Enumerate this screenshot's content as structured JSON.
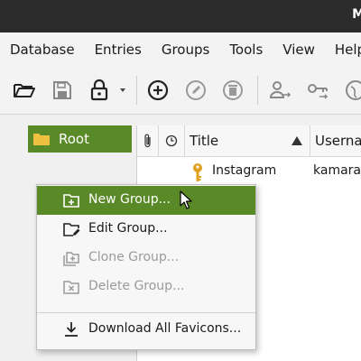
{
  "window": {
    "title_fragment": "M"
  },
  "menubar": {
    "items": [
      {
        "label": "Database"
      },
      {
        "label": "Entries"
      },
      {
        "label": "Groups"
      },
      {
        "label": "Tools"
      },
      {
        "label": "View"
      },
      {
        "label": "Help"
      }
    ]
  },
  "toolbar": {
    "buttons": [
      {
        "icon": "folder-open-icon",
        "enabled": true
      },
      {
        "icon": "save-icon",
        "enabled": false
      },
      {
        "icon": "lock-icon",
        "enabled": true
      },
      {
        "icon": "dropdown-arrow-icon",
        "enabled": true
      },
      {
        "icon": "add-entry-icon",
        "enabled": true
      },
      {
        "icon": "edit-entry-icon",
        "enabled": false
      },
      {
        "icon": "delete-entry-icon",
        "enabled": false
      },
      {
        "icon": "transfer-username-icon",
        "enabled": false
      },
      {
        "icon": "transfer-password-icon",
        "enabled": false
      },
      {
        "icon": "open-url-icon",
        "enabled": false
      }
    ]
  },
  "groups_tree": {
    "root_label": "Root"
  },
  "entries_table": {
    "columns": [
      {
        "icon": "attachment-icon"
      },
      {
        "icon": "clock-icon"
      },
      {
        "label": "Title",
        "sort": "ascending"
      },
      {
        "label": "Userna"
      }
    ],
    "rows": [
      {
        "icon": "key-icon",
        "title": "Instagram",
        "username": "kamara"
      }
    ]
  },
  "context_menu": {
    "items": [
      {
        "label": "New Group...",
        "icon": "new-group-icon",
        "state": "active"
      },
      {
        "label": "Edit Group...",
        "icon": "edit-group-icon",
        "state": "enabled"
      },
      {
        "label": "Clone Group...",
        "icon": "clone-group-icon",
        "state": "disabled"
      },
      {
        "label": "Delete Group...",
        "icon": "delete-group-icon",
        "state": "disabled"
      },
      {
        "label": "Download All Favicons...",
        "icon": "download-icon",
        "state": "enabled"
      }
    ]
  },
  "colors": {
    "accent": "#5a8a28",
    "titlebar": "#2b2b2b",
    "background": "#f0f0f0",
    "key_icon": "#e0a020",
    "folder_icon": "#f0c040"
  }
}
